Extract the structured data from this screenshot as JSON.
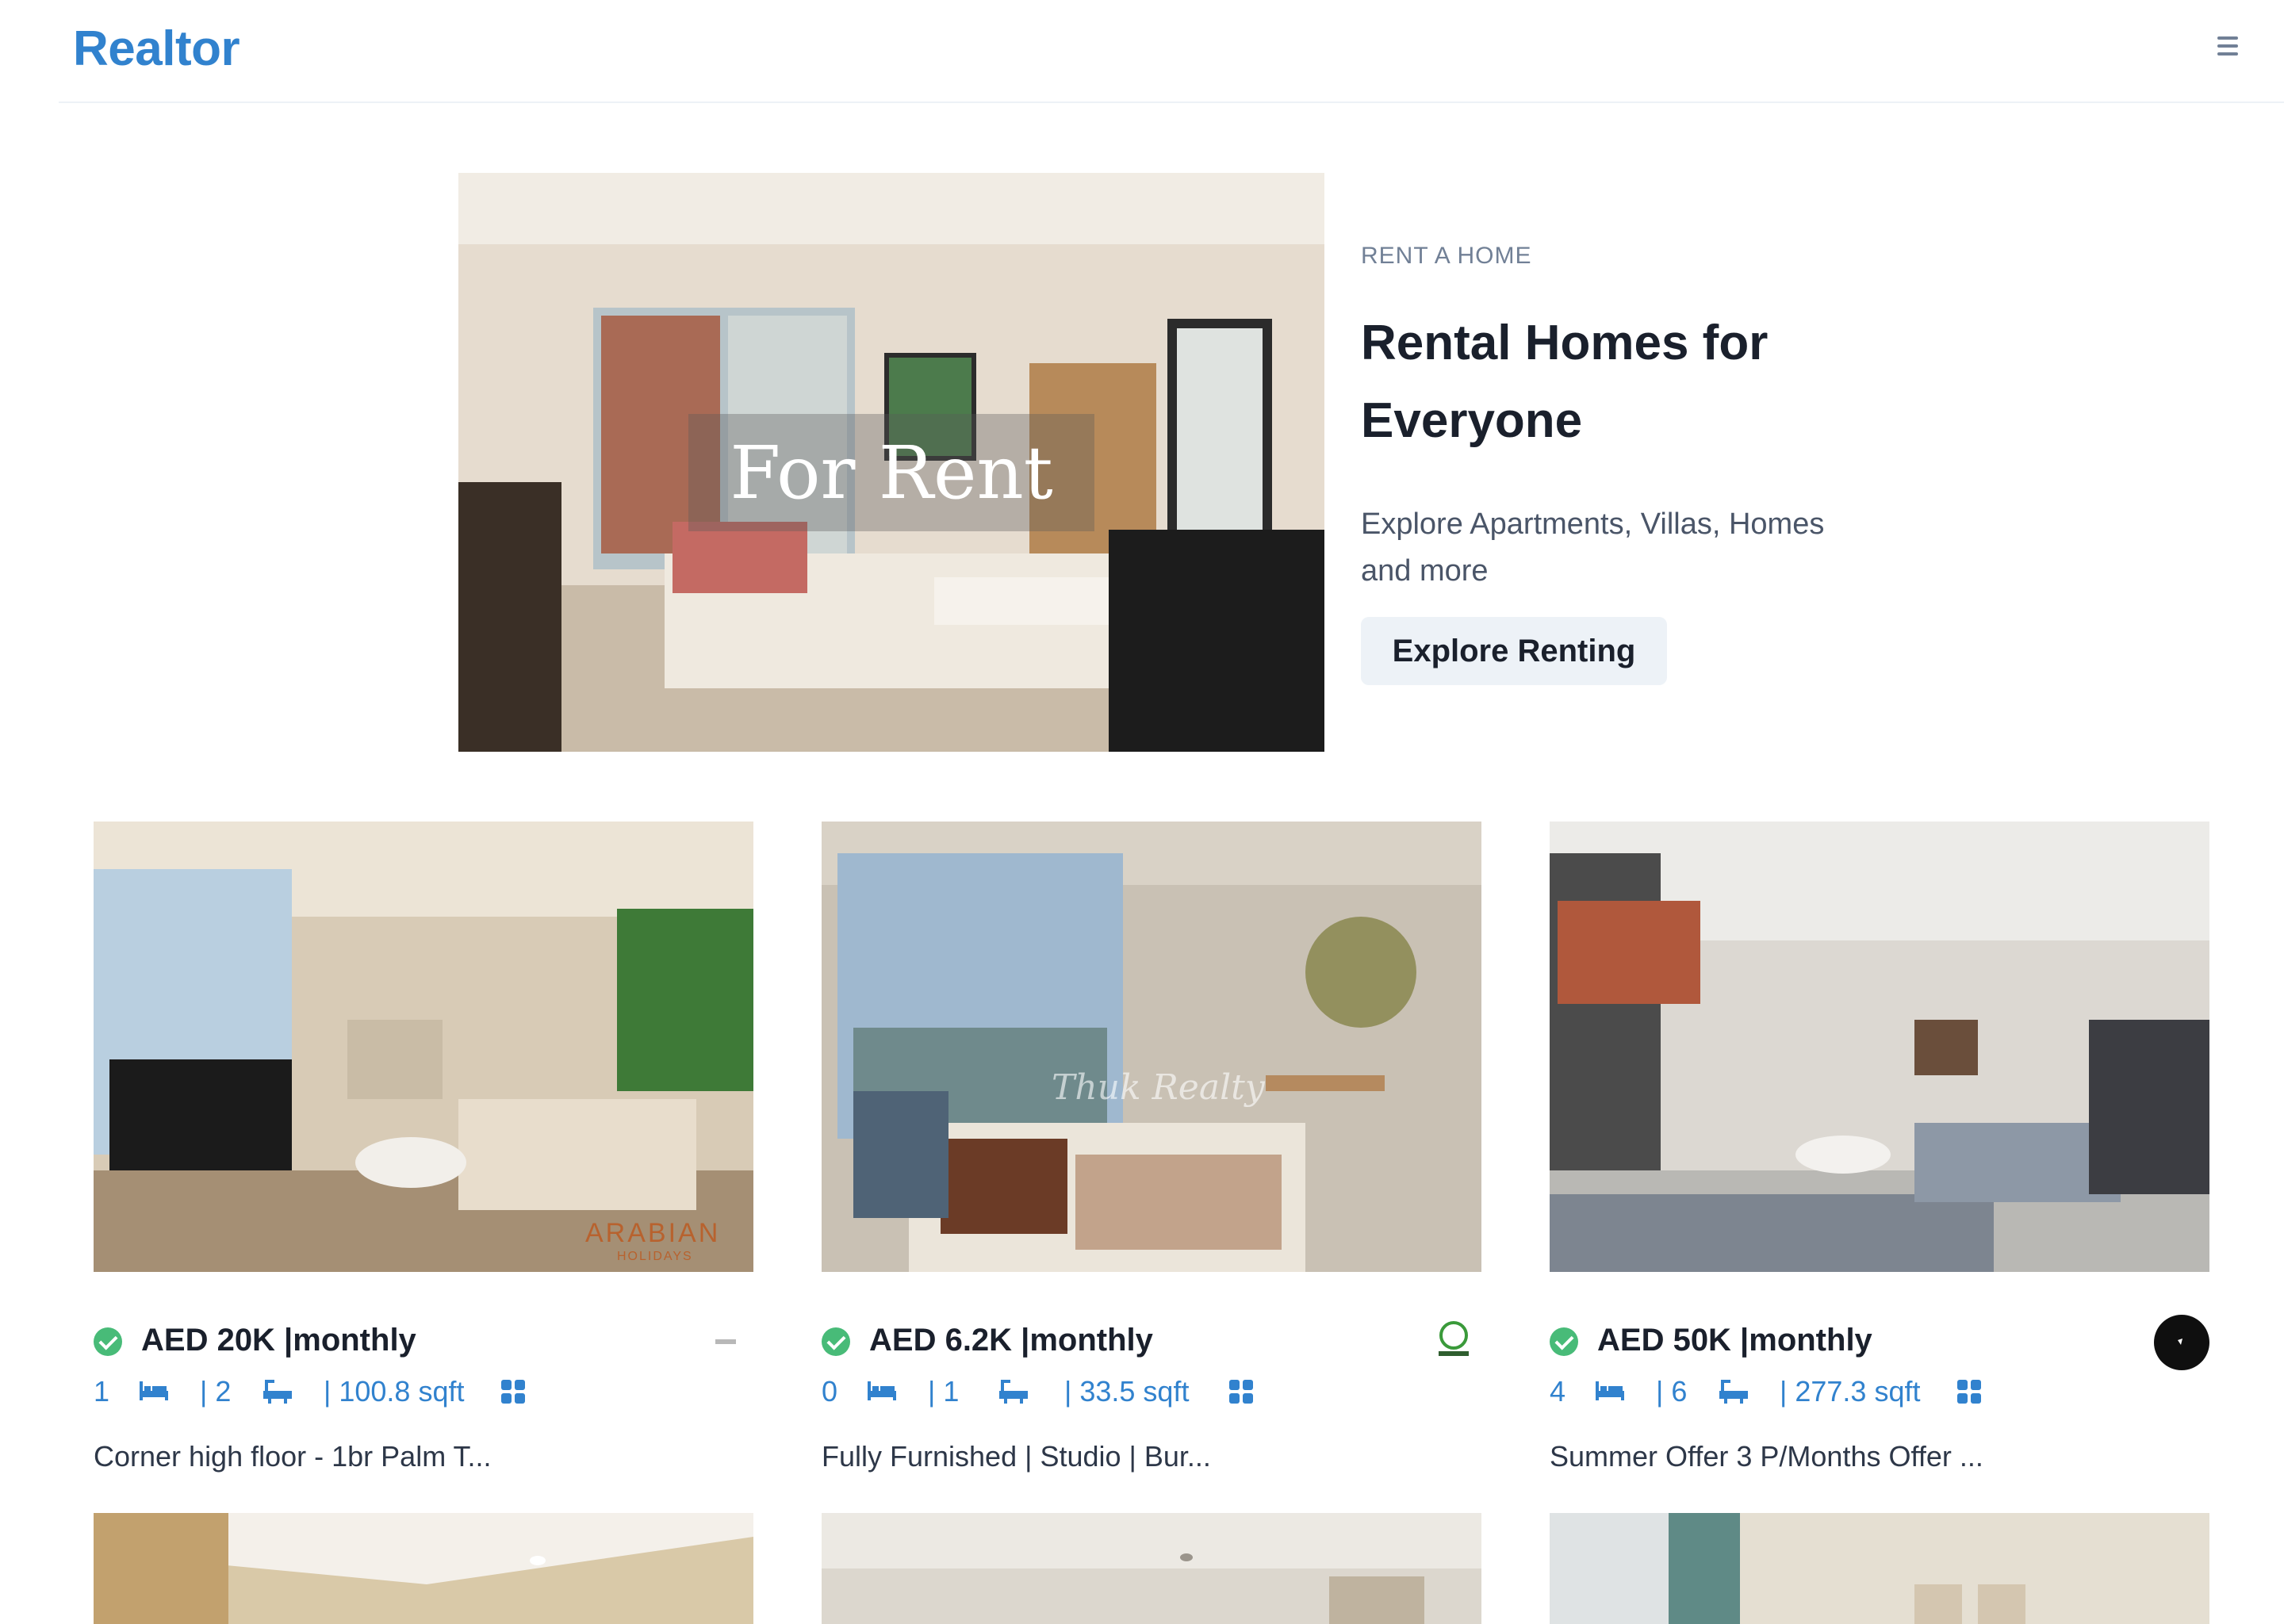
{
  "navbar": {
    "brand": "Realtor",
    "menu_icon": "hamburger-menu-icon"
  },
  "hero": {
    "image_caption": "For Rent",
    "subtitle": "RENT A HOME",
    "title": "Rental Homes for Everyone",
    "description": "Explore Apartments, Villas, Homes and more",
    "button_label": "Explore Renting"
  },
  "listings": [
    {
      "price": "AED 20K |monthly",
      "rooms": "1",
      "baths": "| 2",
      "area": "| 100.8 sqft",
      "title": "Corner high floor - 1br Palm T...",
      "watermark": "ARABIAN",
      "watermark_sub": "HOLIDAYS"
    },
    {
      "price": "AED 6.2K |monthly",
      "rooms": "0",
      "baths": "| 1",
      "area": "| 33.5 sqft",
      "title": "Fully Furnished | Studio | Bur...",
      "watermark": "Thuk Realty"
    },
    {
      "price": "AED 50K |monthly",
      "rooms": "4",
      "baths": "| 6",
      "area": "| 277.3 sqft",
      "title": "Summer Offer 3 P/Months Offer ..."
    }
  ],
  "colors": {
    "brand": "#3182ce",
    "verified": "#48bb78",
    "button_bg": "#edf2f7",
    "muted_text": "#718096"
  }
}
